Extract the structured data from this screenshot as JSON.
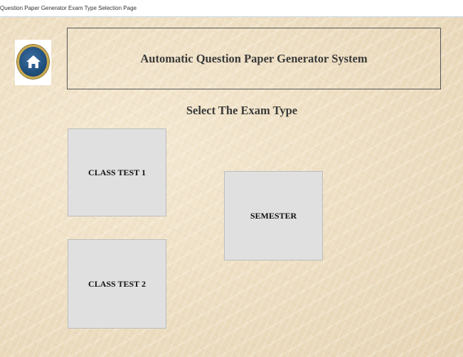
{
  "window": {
    "title": "Question Paper Generator Exam Type Selection Page"
  },
  "header": {
    "title": "Automatic Question Paper Generator System",
    "home_icon": "home-icon"
  },
  "main": {
    "prompt": "Select The Exam Type",
    "buttons": {
      "class_test_1": "CLASS TEST 1",
      "class_test_2": "CLASS TEST 2",
      "semester": "SEMESTER"
    }
  },
  "colors": {
    "background": "#efe1c6",
    "button_bg": "#e0e0e0",
    "badge_blue": "#23527f",
    "badge_gold": "#c9a84e"
  }
}
